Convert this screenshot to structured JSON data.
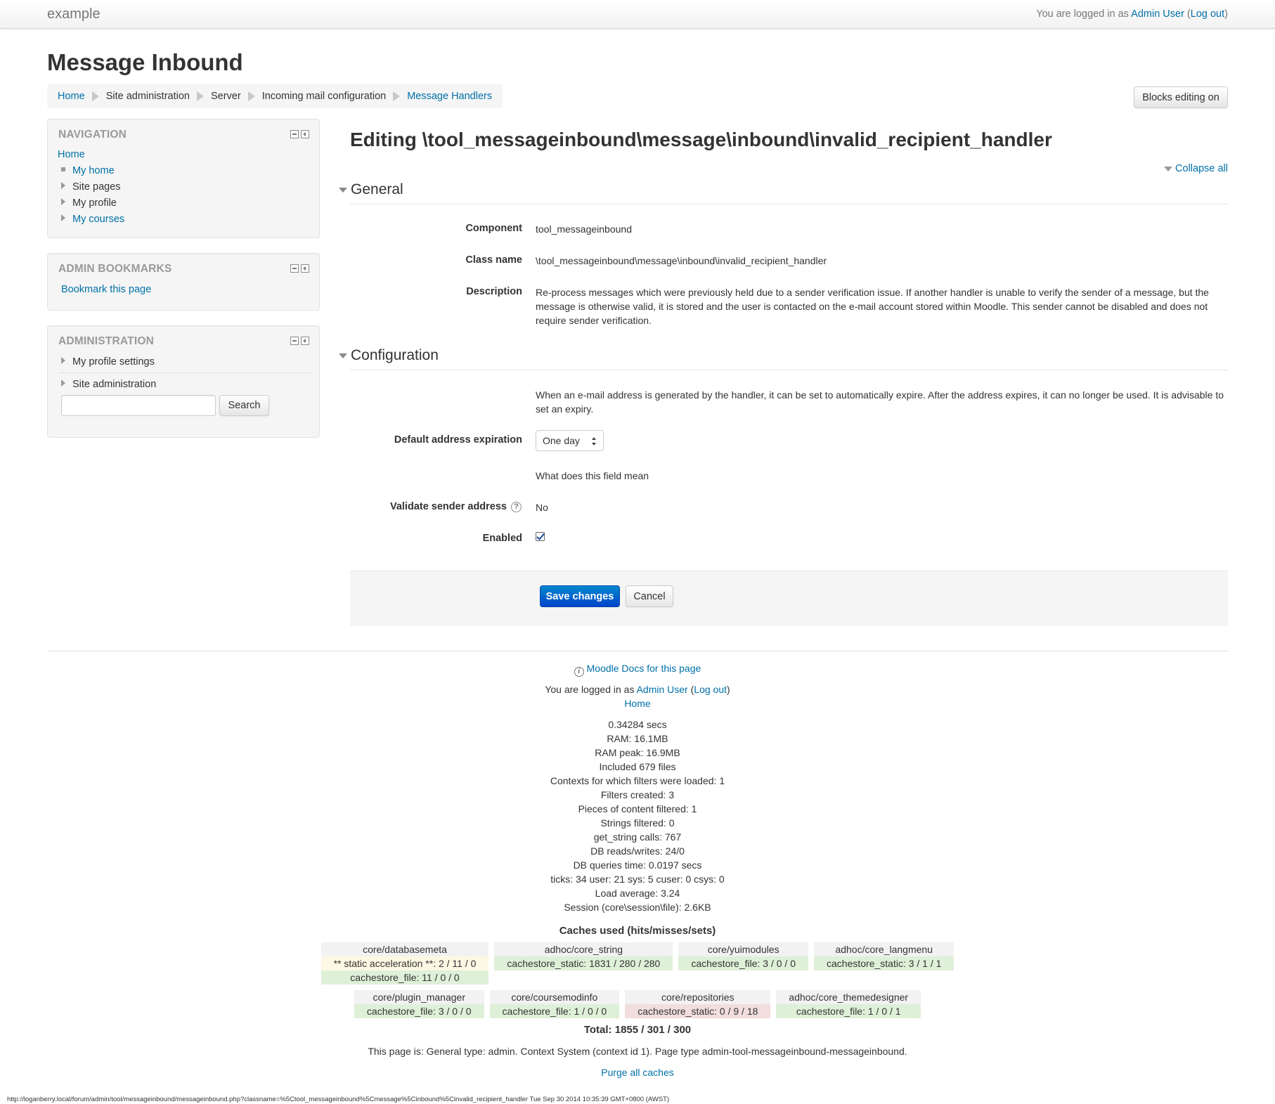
{
  "navbar": {
    "brand": "example",
    "login_prefix": "You are logged in as ",
    "user": "Admin User",
    "logout_open": " (",
    "logout": "Log out",
    "logout_close": ")"
  },
  "page_title": "Message Inbound",
  "breadcrumb": [
    "Home",
    "Site administration",
    "Server",
    "Incoming mail configuration",
    "Message Handlers"
  ],
  "blocks_editing_button": "Blocks editing on",
  "navigation_block": {
    "title": "NAVIGATION",
    "home": "Home",
    "items": [
      "My home",
      "Site pages",
      "My profile",
      "My courses"
    ]
  },
  "admin_bookmarks_block": {
    "title": "ADMIN BOOKMARKS",
    "link": "Bookmark this page"
  },
  "administration_block": {
    "title": "ADMINISTRATION",
    "items": [
      "My profile settings",
      "Site administration"
    ],
    "search_button": "Search",
    "search_value": ""
  },
  "main": {
    "title": "Editing \\tool_messageinbound\\message\\inbound\\invalid_recipient_handler",
    "collapse_all": "Collapse all",
    "general": {
      "legend": "General",
      "component_label": "Component",
      "component_value": "tool_messageinbound",
      "classname_label": "Class name",
      "classname_value": "\\tool_messageinbound\\message\\inbound\\invalid_recipient_handler",
      "description_label": "Description",
      "description_value": "Re-process messages which were previously held due to a sender verification issue. If another handler is unable to verify the sender of a message, but the message is otherwise valid, it is stored and the user is contacted on the e-mail account stored within Moodle. This sender cannot be disabled and does not require sender verification."
    },
    "configuration": {
      "legend": "Configuration",
      "intro": "When an e-mail address is generated by the handler, it can be set to automatically expire. After the address expires, it can no longer be used. It is advisable to set an expiry.",
      "expiration_label": "Default address expiration",
      "expiration_value": "One day",
      "field_help": "What does this field mean",
      "validate_label": "Validate sender address",
      "validate_value": "No",
      "enabled_label": "Enabled",
      "enabled_checked": true
    },
    "save_button": "Save changes",
    "cancel_button": "Cancel"
  },
  "footer": {
    "docs_link": "Moodle Docs for this page",
    "login_prefix": "You are logged in as ",
    "user": "Admin User",
    "logout_open": " (",
    "logout": "Log out",
    "logout_close": ")",
    "home": "Home",
    "stats": [
      "0.34284 secs",
      "RAM: 16.1MB",
      "RAM peak: 16.9MB",
      "Included 679 files",
      "Contexts for which filters were loaded: 1",
      "Filters created: 3",
      "Pieces of content filtered: 1",
      "Strings filtered: 0",
      "get_string calls: 767",
      "DB reads/writes: 24/0",
      "DB queries time: 0.0197 secs",
      "ticks: 34 user: 21 sys: 5 cuser: 0 csys: 0",
      "Load average: 3.24",
      "Session (core\\session\\file): 2.6KB"
    ],
    "caches_title": "Caches used (hits/misses/sets)",
    "caches_row1": [
      {
        "name": "core/databasemeta",
        "stores": [
          {
            "text": "** static acceleration **: 2 / 11 / 0",
            "status": "warn"
          },
          {
            "text": "cachestore_file: 11 / 0 / 0",
            "status": "ok"
          }
        ]
      },
      {
        "name": "adhoc/core_string",
        "stores": [
          {
            "text": "cachestore_static: 1831 / 280 / 280",
            "status": "ok"
          }
        ]
      },
      {
        "name": "core/yuimodules",
        "stores": [
          {
            "text": "cachestore_file: 3 / 0 / 0",
            "status": "ok"
          }
        ]
      },
      {
        "name": "adhoc/core_langmenu",
        "stores": [
          {
            "text": "cachestore_static: 3 / 1 / 1",
            "status": "ok"
          }
        ]
      }
    ],
    "caches_row2": [
      {
        "name": "core/plugin_manager",
        "stores": [
          {
            "text": "cachestore_file: 3 / 0 / 0",
            "status": "ok"
          }
        ]
      },
      {
        "name": "core/coursemodinfo",
        "stores": [
          {
            "text": "cachestore_file: 1 / 0 / 0",
            "status": "ok"
          }
        ]
      },
      {
        "name": "core/repositories",
        "stores": [
          {
            "text": "cachestore_static: 0 / 9 / 18",
            "status": "bad"
          }
        ]
      },
      {
        "name": "adhoc/core_themedesigner",
        "stores": [
          {
            "text": "cachestore_file: 1 / 0 / 1",
            "status": "ok"
          }
        ]
      }
    ],
    "total": "Total: 1855 / 301 / 300",
    "page_type": "This page is: General type: admin. Context System (context id 1). Page type admin-tool-messageinbound-messageinbound.",
    "purge": "Purge all caches"
  },
  "statusbar": "http://loganberry.local/forum/admin/tool/messageinbound/messageinbound.php?classname=%5Ctool_messageinbound%5Cmessage%5Cinbound%5Cinvalid_recipient_handler Tue Sep 30 2014 10:35:39 GMT+0800 (AWST)",
  "colors": {
    "link": "#0070a8",
    "primary_button": "#0055cc",
    "cache_ok": "#dff0d8",
    "cache_warn": "#fcf8e3",
    "cache_bad": "#f2dede"
  }
}
